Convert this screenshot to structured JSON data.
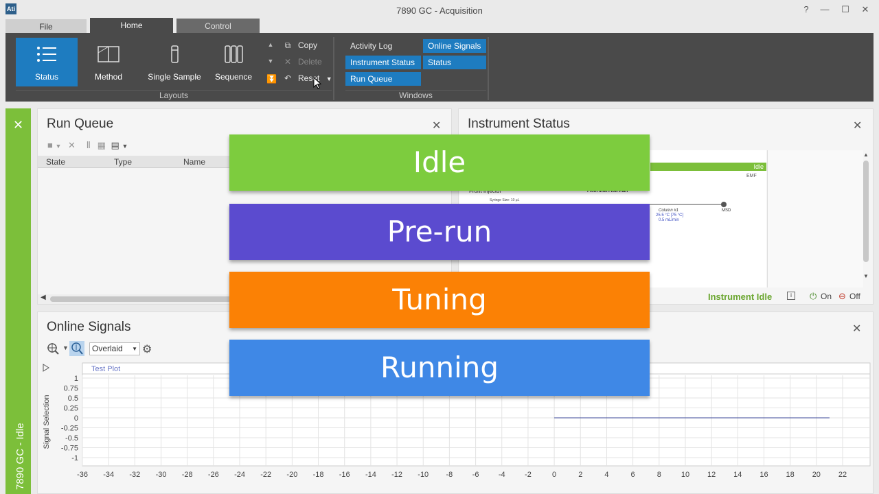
{
  "window": {
    "logo": "Ati",
    "title": "7890 GC - Acquisition",
    "help": "?",
    "minimize": "—",
    "maximize": "☐",
    "close": "✕"
  },
  "ribbon_tabs": [
    "File",
    "Home",
    "Control"
  ],
  "layouts": {
    "buttons": [
      "Status",
      "Method",
      "Single Sample",
      "Sequence"
    ],
    "group_label": "Layouts",
    "copy": "Copy",
    "delete": "Delete",
    "reset": "Reset"
  },
  "windows": {
    "group_label": "Windows",
    "activity_log": "Activity Log",
    "online_signals": "Online Signals",
    "instrument_status": "Instrument Status",
    "status": "Status",
    "run_queue": "Run Queue"
  },
  "side_strip": {
    "label": "7890 GC - Idle",
    "color": "#7cbf3a"
  },
  "run_queue": {
    "title": "Run Queue",
    "columns": [
      "State",
      "Type",
      "Name"
    ]
  },
  "instrument_status": {
    "title": "Instrument Status",
    "bar_label": "Idle",
    "emf": "EMF",
    "front_injector": "Front Injector",
    "syringe": "Syringe Size: 10 µL",
    "flow_path": "Front Inlet Flow Path",
    "column_name": "Column #1",
    "column_temp": "25.5 °C [75 °C]",
    "column_flow": "0.5 mL/min",
    "msd": "MSD",
    "state_text": "Instrument Idle",
    "on_label": "On",
    "off_label": "Off"
  },
  "online_signals": {
    "title": "Online Signals",
    "mode": "Overlaid"
  },
  "banners": [
    {
      "label": "Idle",
      "color": "#7dcc3e"
    },
    {
      "label": "Pre-run",
      "color": "#5b4bcf"
    },
    {
      "label": "Tuning",
      "color": "#fb8105"
    },
    {
      "label": "Running",
      "color": "#3f88e6"
    }
  ],
  "chart_data": {
    "type": "line",
    "title": "Test Plot",
    "ylabel": "Signal Selection",
    "xlim": [
      -36,
      22
    ],
    "ylim": [
      -1,
      1
    ],
    "x_ticks": [
      -36,
      -34,
      -32,
      -30,
      -28,
      -26,
      -24,
      -22,
      -20,
      -18,
      -16,
      -14,
      -12,
      -10,
      -8,
      -6,
      -4,
      -2,
      0,
      2,
      4,
      6,
      8,
      10,
      12,
      14,
      16,
      18,
      20,
      22
    ],
    "y_ticks": [
      1,
      0.75,
      0.5,
      0.25,
      0,
      -0.25,
      -0.5,
      -0.75,
      -1
    ],
    "y_tick_labels": [
      "1",
      "0.75",
      "0.5",
      "0.25",
      "0",
      "-0.25",
      "-0.5",
      "-0.75",
      "-1"
    ],
    "grid": true,
    "series": [
      {
        "x": [
          0,
          21
        ],
        "y": [
          0,
          0
        ],
        "color": "#3d4a9a"
      }
    ]
  }
}
